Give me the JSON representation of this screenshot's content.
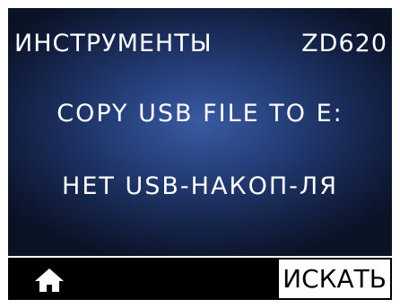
{
  "header": {
    "menu_title": "ИНСТРУМЕНТЫ",
    "model": "ZD620"
  },
  "main": {
    "line1": "COPY USB FILE TO E:",
    "line2": "НЕТ USB-НАКОП-ЛЯ"
  },
  "footer": {
    "home_icon": "home-icon",
    "search_label": "ИСКАТЬ"
  },
  "colors": {
    "background_center": "#3a5aa2",
    "background_edge": "#0a1226",
    "bottom_bar": "#000000",
    "selected_button_bg": "#ffffff"
  }
}
